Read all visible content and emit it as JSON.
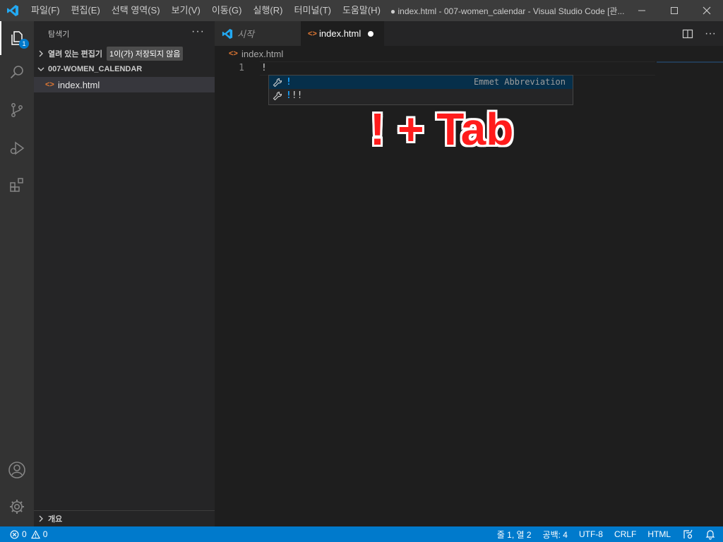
{
  "titlebar": {
    "menus": [
      "파일(F)",
      "편집(E)",
      "선택 영역(S)",
      "보기(V)",
      "이동(G)",
      "실행(R)",
      "터미널(T)",
      "도움말(H)"
    ],
    "window_title": "● index.html - 007-women_calendar - Visual Studio Code [관..."
  },
  "activitybar": {
    "explorer_badge": "1"
  },
  "sidebar": {
    "title": "탐색기",
    "more": "···",
    "open_editors_label": "열려 있는 편집기",
    "unsaved_badge": "1이(가) 저장되지 않음",
    "folder_name": "007-WOMEN_CALENDAR",
    "files": [
      {
        "icon": "<>",
        "name": "index.html"
      }
    ],
    "outline_label": "개요"
  },
  "editor": {
    "tabs": [
      {
        "label": "시작",
        "active": false
      },
      {
        "label": "index.html",
        "active": true,
        "dirty": true
      }
    ],
    "breadcrumb": "index.html",
    "lines": [
      {
        "no": "1",
        "text": "!"
      }
    ]
  },
  "suggest": {
    "items": [
      {
        "match": "!",
        "rest": "",
        "detail": "Emmet Abbreviation",
        "selected": true
      },
      {
        "match": "!",
        "rest": "!!",
        "detail": "",
        "selected": false
      }
    ]
  },
  "annotation": "! + Tab",
  "statusbar": {
    "errors": "0",
    "warnings": "0",
    "position": "줄 1, 열 2",
    "spaces": "공백: 4",
    "encoding": "UTF-8",
    "eol": "CRLF",
    "language": "HTML"
  },
  "colors": {
    "accent": "#007acc",
    "annotation": "#ff1c1c",
    "file_icon": "#e37933",
    "match_highlight": "#18a3ff"
  }
}
